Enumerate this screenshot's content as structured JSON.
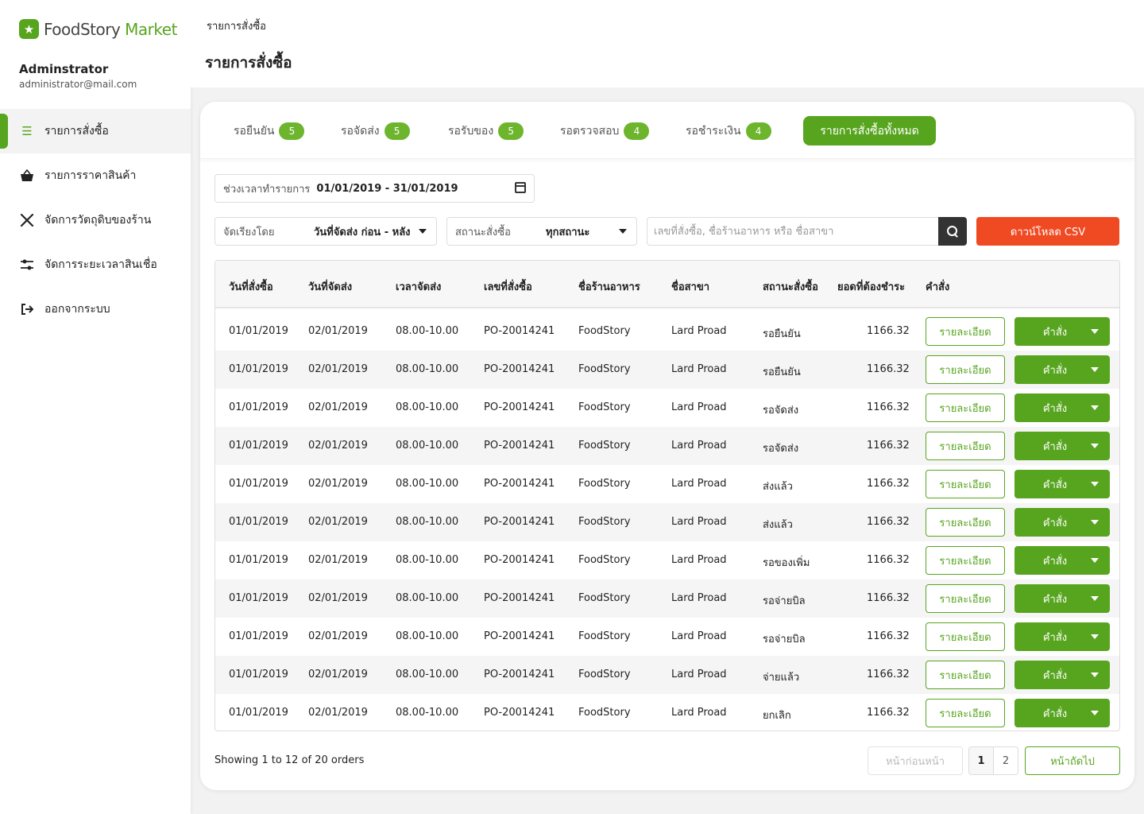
{
  "brand": {
    "name_part1": "FoodStory",
    "name_part2": " Market"
  },
  "user": {
    "name": "Adminstrator",
    "email": "administrator@mail.com"
  },
  "nav": [
    {
      "label": "รายการสั่งซื้อ",
      "icon": "list-icon",
      "active": true
    },
    {
      "label": "รายการราคาสินค้า",
      "icon": "basket-icon",
      "active": false
    },
    {
      "label": "จัดการวัตถุดิบของร้าน",
      "icon": "utensils-icon",
      "active": false
    },
    {
      "label": "จัดการระยะเวลาสินเชื่อ",
      "icon": "sliders-icon",
      "active": false
    },
    {
      "label": "ออกจากระบบ",
      "icon": "logout-icon",
      "active": false
    }
  ],
  "breadcrumb": "รายการสั่งซื้อ",
  "page_title": "รายการสั่งซื้อ",
  "tabs": [
    {
      "label": "รอยืนยัน",
      "count": "5"
    },
    {
      "label": "รอจัดส่ง",
      "count": "5"
    },
    {
      "label": "รอรับของ",
      "count": "5"
    },
    {
      "label": "รอตรวจสอบ",
      "count": "4"
    },
    {
      "label": "รอชำระเงิน",
      "count": "4"
    }
  ],
  "tab_all": "รายการสั่งซื้อทั้งหมด",
  "filters": {
    "date_label": "ช่วงเวลาทำรายการ",
    "date_value": "01/01/2019 - 31/01/2019",
    "sort_label": "จัดเรียงโดย",
    "sort_value": "วันที่จัดส่ง ก่อน - หลัง",
    "status_label": "สถานะสั่งซื้อ",
    "status_value": "ทุกสถานะ",
    "search_placeholder": "เลขที่สั่งซื้อ, ชื่อร้านอาหาร หรือ ชื่อสาขา",
    "csv_label": "ดาวน์โหลด CSV"
  },
  "table": {
    "headers": [
      "วันที่สั่งซื้อ",
      "วันที่จัดส่ง",
      "เวลาจัดส่ง",
      "เลขที่สั่งซื้อ",
      "ชื่อร้านอาหาร",
      "ชื่อสาขา",
      "สถานะสั่งซื้อ",
      "ยอดที่ต้องชำระ",
      "คำสั่ง"
    ],
    "detail_label": "รายละเอียด",
    "command_label": "คำสั่ง",
    "rows": [
      [
        "01/01/2019",
        "02/01/2019",
        "08.00-10.00",
        "PO-20014241",
        "FoodStory",
        "Lard Proad",
        "รอยืนยัน",
        "1166.32"
      ],
      [
        "01/01/2019",
        "02/01/2019",
        "08.00-10.00",
        "PO-20014241",
        "FoodStory",
        "Lard Proad",
        "รอยืนยัน",
        "1166.32"
      ],
      [
        "01/01/2019",
        "02/01/2019",
        "08.00-10.00",
        "PO-20014241",
        "FoodStory",
        "Lard Proad",
        "รอจัดส่ง",
        "1166.32"
      ],
      [
        "01/01/2019",
        "02/01/2019",
        "08.00-10.00",
        "PO-20014241",
        "FoodStory",
        "Lard Proad",
        "รอจัดส่ง",
        "1166.32"
      ],
      [
        "01/01/2019",
        "02/01/2019",
        "08.00-10.00",
        "PO-20014241",
        "FoodStory",
        "Lard Proad",
        "ส่งแล้ว",
        "1166.32"
      ],
      [
        "01/01/2019",
        "02/01/2019",
        "08.00-10.00",
        "PO-20014241",
        "FoodStory",
        "Lard Proad",
        "ส่งแล้ว",
        "1166.32"
      ],
      [
        "01/01/2019",
        "02/01/2019",
        "08.00-10.00",
        "PO-20014241",
        "FoodStory",
        "Lard Proad",
        "รอของเพิ่ม",
        "1166.32"
      ],
      [
        "01/01/2019",
        "02/01/2019",
        "08.00-10.00",
        "PO-20014241",
        "FoodStory",
        "Lard Proad",
        "รอจ่ายบิล",
        "1166.32"
      ],
      [
        "01/01/2019",
        "02/01/2019",
        "08.00-10.00",
        "PO-20014241",
        "FoodStory",
        "Lard Proad",
        "รอจ่ายบิล",
        "1166.32"
      ],
      [
        "01/01/2019",
        "02/01/2019",
        "08.00-10.00",
        "PO-20014241",
        "FoodStory",
        "Lard Proad",
        "จ่ายแล้ว",
        "1166.32"
      ],
      [
        "01/01/2019",
        "02/01/2019",
        "08.00-10.00",
        "PO-20014241",
        "FoodStory",
        "Lard Proad",
        "ยกเลิก",
        "1166.32"
      ]
    ]
  },
  "pagination": {
    "showing": "Showing 1 to 12 of 20 orders",
    "prev": "หน้าก่อนหน้า",
    "pages": [
      "1",
      "2"
    ],
    "next": "หน้าถัดไป"
  },
  "colors": {
    "brand_green": "#57a51e",
    "csv_orange": "#f04a23"
  }
}
